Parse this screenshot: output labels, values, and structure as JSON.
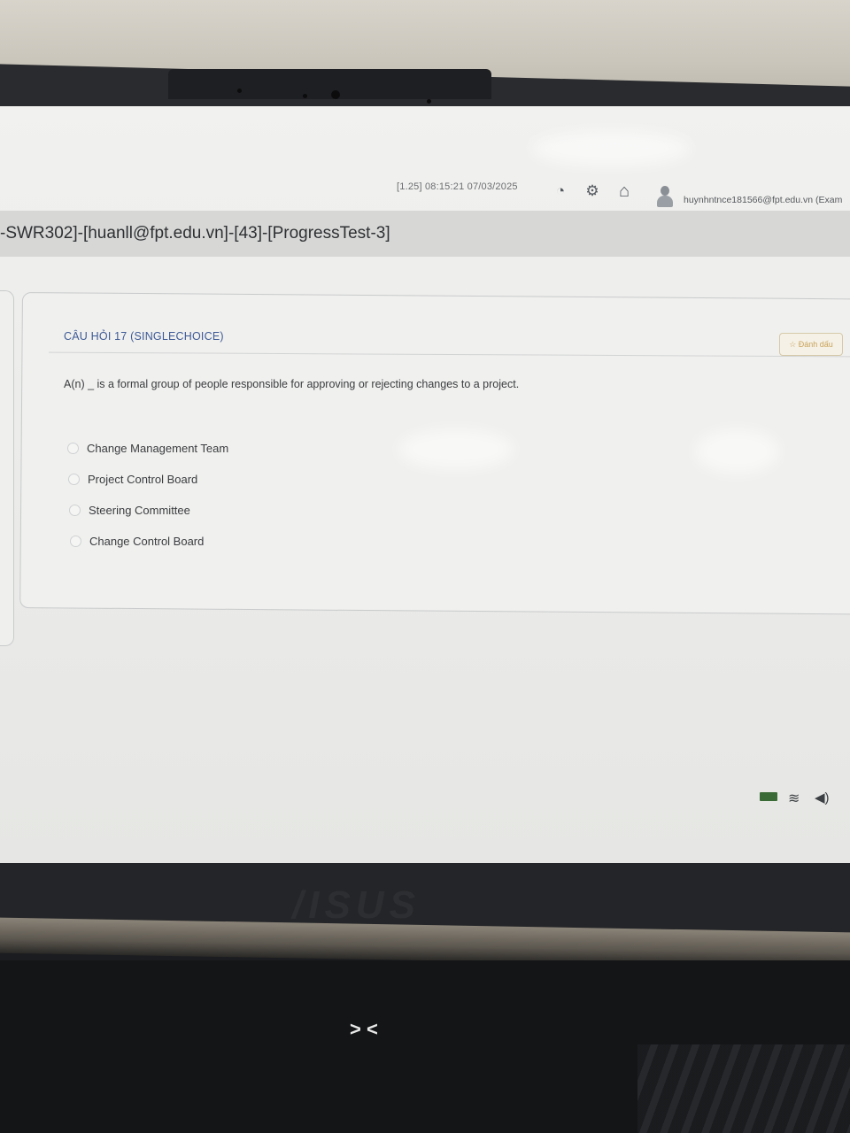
{
  "header": {
    "timestamp": "[1.25]  08:15:21 07/03/2025",
    "user_email": "huynhntnce181566@fpt.edu.vn (Exam"
  },
  "icons": {
    "dashboard": "◔",
    "settings": "⚙",
    "home": "⌂"
  },
  "exam": {
    "title": "-SWR302]-[huanll@fpt.edu.vn]-[43]-[ProgressTest-3]"
  },
  "question": {
    "title": "CÂU HỎI 17 (SINGLECHOICE)",
    "mark_label": "☆ Đánh dấu",
    "text": "A(n) _ is a formal group of people responsible for approving or rejecting changes to a project.",
    "options": [
      "Change Management Team",
      "Project Control Board",
      "Steering Committee",
      "Change Control Board"
    ]
  },
  "laptop": {
    "brand": "/ISUS"
  },
  "colors": {
    "question_title": "#3e5a97",
    "screen_bg": "#f0f0ee"
  }
}
